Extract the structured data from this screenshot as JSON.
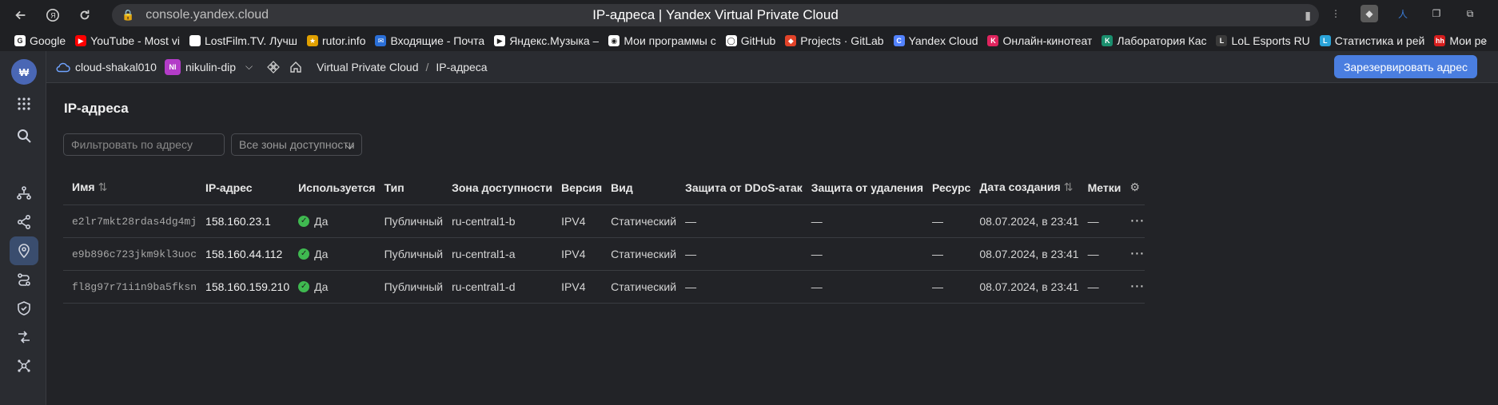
{
  "browser": {
    "url": "console.yandex.cloud",
    "title": "IP-адреса | Yandex Virtual Private Cloud"
  },
  "bookmarks": [
    {
      "label": "Google",
      "color": "#ffffff",
      "glyph": "G"
    },
    {
      "label": "YouTube - Most vi",
      "color": "#ff0000",
      "glyph": "▶"
    },
    {
      "label": "LostFilm.TV. Лучш",
      "color": "#ffffff",
      "glyph": ""
    },
    {
      "label": "rutor.info",
      "color": "#e0a000",
      "glyph": "★"
    },
    {
      "label": "Входящие - Почта",
      "color": "#2a6fd8",
      "glyph": "✉"
    },
    {
      "label": "Яндекс.Музыка –",
      "color": "#ffffff",
      "glyph": "▶"
    },
    {
      "label": "Мои программы с",
      "color": "#ffffff",
      "glyph": "◉"
    },
    {
      "label": "GitHub",
      "color": "#ffffff",
      "glyph": "◯"
    },
    {
      "label": "Projects · GitLab",
      "color": "#e24329",
      "glyph": "◆"
    },
    {
      "label": "Yandex Cloud",
      "color": "#5282ff",
      "glyph": "C"
    },
    {
      "label": "Онлайн-кинотеат",
      "color": "#e0245e",
      "glyph": "K"
    },
    {
      "label": "Лаборатория Кас",
      "color": "#1a8f6e",
      "glyph": "K"
    },
    {
      "label": "LoL Esports RU",
      "color": "#3a3a3a",
      "glyph": "L"
    },
    {
      "label": "Статистика и рей",
      "color": "#2aa3d8",
      "glyph": "L"
    },
    {
      "label": "Мои ре",
      "color": "#d71d1d",
      "glyph": "hh"
    }
  ],
  "header": {
    "cloud": "cloud-shakal010",
    "folder_badge": "NI",
    "folder": "nikulin-dip",
    "service": "Virtual Private Cloud",
    "separator": "/",
    "page": "IP-адреса",
    "reserve_button": "Зарезервировать адрес"
  },
  "main": {
    "title": "IP-адреса",
    "filter_placeholder": "Фильтровать по адресу",
    "zone_select": "Все зоны доступности"
  },
  "table": {
    "columns": {
      "name": "Имя",
      "ip": "IP-адрес",
      "used": "Используется",
      "type": "Тип",
      "zone": "Зона доступности",
      "version": "Версия",
      "kind": "Вид",
      "ddos": "Защита от DDoS-атак",
      "deletion": "Защита от удаления",
      "resource": "Ресурс",
      "created": "Дата создания",
      "labels": "Метки"
    },
    "rows": [
      {
        "name": "e2lr7mkt28rdas4dg4mj",
        "ip": "158.160.23.1",
        "used": "Да",
        "type": "Публичный",
        "zone": "ru-central1-b",
        "version": "IPV4",
        "kind": "Статический",
        "ddos": "—",
        "deletion": "—",
        "resource": "—",
        "created": "08.07.2024, в 23:41",
        "labels": "—"
      },
      {
        "name": "e9b896c723jkm9kl3uoc",
        "ip": "158.160.44.112",
        "used": "Да",
        "type": "Публичный",
        "zone": "ru-central1-a",
        "version": "IPV4",
        "kind": "Статический",
        "ddos": "—",
        "deletion": "—",
        "resource": "—",
        "created": "08.07.2024, в 23:41",
        "labels": "—"
      },
      {
        "name": "fl8g97r71i1n9ba5fksn",
        "ip": "158.160.159.210",
        "used": "Да",
        "type": "Публичный",
        "zone": "ru-central1-d",
        "version": "IPV4",
        "kind": "Статический",
        "ddos": "—",
        "deletion": "—",
        "resource": "—",
        "created": "08.07.2024, в 23:41",
        "labels": "—"
      }
    ]
  },
  "colors": {
    "accent": "#4a7ee0",
    "status_ok": "#3fb950",
    "background": "#222327"
  }
}
